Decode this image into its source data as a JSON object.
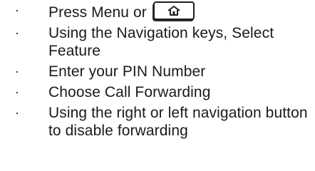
{
  "steps": [
    {
      "bullet": "·",
      "text": "Press Menu or"
    },
    {
      "bullet": "·",
      "text": "Using the Navigation keys, Select Feature"
    },
    {
      "bullet": "·",
      "text": "Enter your PIN Number"
    },
    {
      "bullet": "·",
      "text": "Choose Call Forwarding"
    },
    {
      "bullet": "·",
      "text": "Using the right or left navigation button to disable forwarding"
    }
  ],
  "icons": {
    "home_key": "home-icon"
  }
}
